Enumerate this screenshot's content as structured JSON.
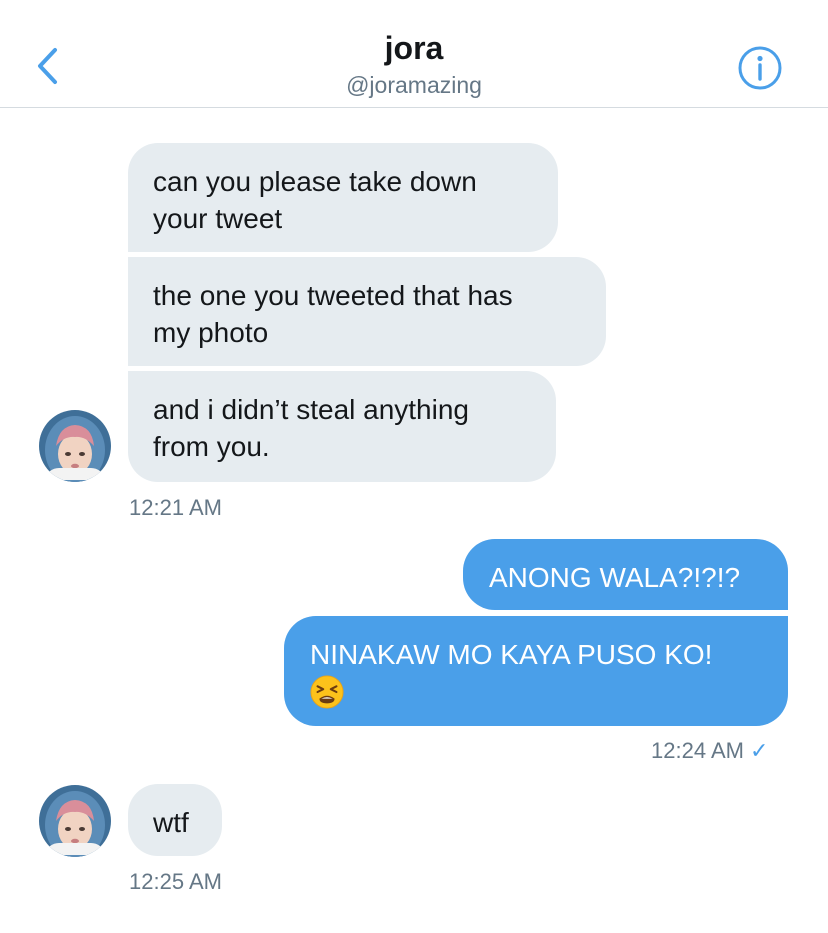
{
  "header": {
    "title": "jora",
    "handle": "@joramazing",
    "back_icon": "chevron-left-icon",
    "info_icon": "info-icon"
  },
  "messages": [
    {
      "direction": "received",
      "text": "can you please take down\nyour tweet"
    },
    {
      "direction": "received",
      "text": "the one you tweeted that has\nmy photo"
    },
    {
      "direction": "received",
      "text": "and i didn’t steal anything\nfrom you."
    },
    {
      "direction": "sent",
      "text": "ANONG WALA?!?!?"
    },
    {
      "direction": "sent",
      "text": "NINAKAW MO KAYA PUSO KO!",
      "emoji": "tired-face-emoji"
    },
    {
      "direction": "received",
      "text": "wtf"
    }
  ],
  "timestamps": {
    "group1": "12:21 AM",
    "group2": "12:24 AM",
    "group3": "12:25 AM"
  },
  "read_receipt": "✓",
  "colors": {
    "accent": "#4a9fe9",
    "received_bubble": "#e6ecf0",
    "secondary_text": "#657786"
  }
}
